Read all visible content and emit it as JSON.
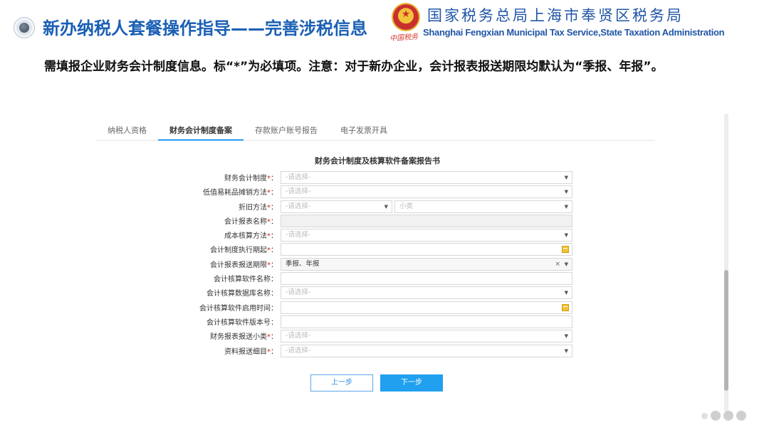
{
  "header": {
    "title": "新办纳税人套餐操作指导——完善涉税信息",
    "org_cn": "国家税务总局上海市奉贤区税务局",
    "org_en": "Shanghai Fengxian Municipal Tax Service,State Taxation Administration",
    "signature": "中国税务"
  },
  "description": "需填报企业财务会计制度信息。标“*”为必填项。注意：对于新办企业，会计报表报送期限均默认为“季报、年报”。",
  "tabs": [
    {
      "label": "纳税人资格",
      "active": false
    },
    {
      "label": "财务会计制度备案",
      "active": true
    },
    {
      "label": "存款账户账号报告",
      "active": false
    },
    {
      "label": "电子发票开具",
      "active": false
    }
  ],
  "form": {
    "title": "财务会计制度及核算软件备案报告书",
    "placeholder_select": "-请选择-",
    "placeholder_unit": "小类",
    "fields": [
      {
        "label": "财务会计制度",
        "required": "*",
        "value": "-请选择-"
      },
      {
        "label": "低值易耗品摊销方法",
        "required": "*",
        "value": "-请选择-"
      },
      {
        "label": "折旧方法",
        "required": "*",
        "value": "-请选择-",
        "value2": "小类"
      },
      {
        "label": "会计报表名称",
        "required": "*",
        "value": ""
      },
      {
        "label": "成本核算方法",
        "required": "*",
        "value": "-请选择-"
      },
      {
        "label": "会计制度执行期起",
        "required": "*",
        "value": ""
      },
      {
        "label": "会计报表报送期限",
        "required": "*",
        "value": "季报、年报",
        "clear": "×"
      },
      {
        "label": "会计核算软件名称",
        "required": "",
        "value": ""
      },
      {
        "label": "会计核算数据库名称",
        "required": "",
        "value": "-请选择-"
      },
      {
        "label": "会计核算软件启用时间",
        "required": "",
        "value": ""
      },
      {
        "label": "会计核算软件版本号",
        "required": "",
        "value": ""
      },
      {
        "label": "财务报表报送小类",
        "required": "*",
        "value": "-请选择-"
      },
      {
        "label": "资料报送细目",
        "required": "*",
        "value": "-请选择-"
      }
    ],
    "colon": "："
  },
  "buttons": {
    "prev": "上一步",
    "next": "下一步"
  },
  "colors": {
    "title_blue": "#1a5fb4",
    "accent": "#21a0f0",
    "required": "#e02020"
  }
}
